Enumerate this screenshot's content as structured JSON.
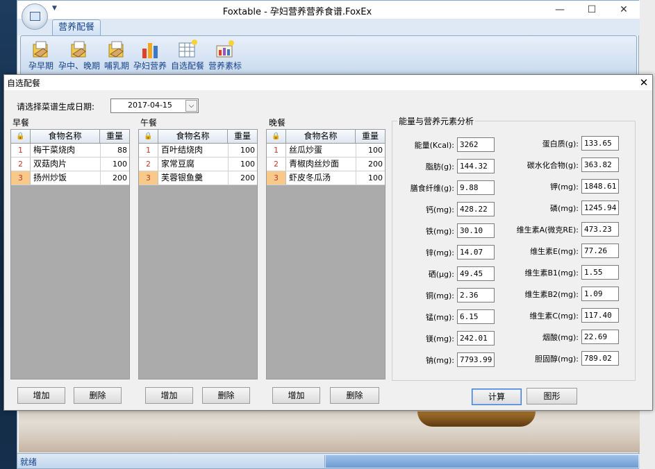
{
  "app": {
    "title": "Foxtable - 孕妇营养营养食谱.FoxEx",
    "qat_icon": "dropdown-arrow",
    "ribbon_tab": "营养配餐",
    "ribbon_buttons": [
      {
        "label": "孕早期",
        "icon": "folder-hand-icon"
      },
      {
        "label": "孕中、晚期",
        "icon": "folder-hand-icon"
      },
      {
        "label": "哺乳期",
        "icon": "folder-hand-icon"
      },
      {
        "label": "孕妇营养",
        "icon": "bar-chart-icon"
      },
      {
        "label": "自选配餐",
        "icon": "table-star-icon"
      },
      {
        "label": "营养素标",
        "icon": "chart-star-icon"
      }
    ],
    "status": "就绪",
    "window_controls": {
      "minimize": "—",
      "maximize": "☐",
      "close": "✕"
    }
  },
  "dialog": {
    "title": "自选配餐",
    "close": "✕",
    "date_label": "请选择菜谱生成日期:",
    "date_value": "2017-04-15",
    "date_drop": "⌵",
    "grid_header": {
      "corner": "🔒",
      "name": "食物名称",
      "weight": "重量"
    },
    "meals": [
      {
        "title": "早餐",
        "rows": [
          {
            "n": "1",
            "name": "梅干菜烧肉",
            "weight": "88"
          },
          {
            "n": "2",
            "name": "双菇肉片",
            "weight": "100"
          },
          {
            "n": "3",
            "name": "扬州炒饭",
            "weight": "200"
          }
        ],
        "add": "增加",
        "del": "删除"
      },
      {
        "title": "午餐",
        "rows": [
          {
            "n": "1",
            "name": "百叶结烧肉",
            "weight": "100"
          },
          {
            "n": "2",
            "name": "家常豆腐",
            "weight": "100"
          },
          {
            "n": "3",
            "name": "芙蓉银鱼羹",
            "weight": "200"
          }
        ],
        "add": "增加",
        "del": "删除"
      },
      {
        "title": "晚餐",
        "rows": [
          {
            "n": "1",
            "name": "丝瓜炒蛋",
            "weight": "100"
          },
          {
            "n": "2",
            "name": "青椒肉丝炒面",
            "weight": "200"
          },
          {
            "n": "3",
            "name": "虾皮冬瓜汤",
            "weight": "100"
          }
        ],
        "add": "增加",
        "del": "删除"
      }
    ],
    "nutrition": {
      "title": "能量与营养元素分析",
      "left": [
        {
          "label": "能量(Kcal):",
          "value": "3262"
        },
        {
          "label": "脂肪(g):",
          "value": "144.32"
        },
        {
          "label": "膳食纤维(g):",
          "value": "9.88"
        },
        {
          "label": "钙(mg):",
          "value": "428.22"
        },
        {
          "label": "铁(mg):",
          "value": "30.10"
        },
        {
          "label": "锌(mg):",
          "value": "14.07"
        },
        {
          "label": "硒(μg):",
          "value": "49.45"
        },
        {
          "label": "铜(mg):",
          "value": "2.36"
        },
        {
          "label": "锰(mg):",
          "value": "6.15"
        },
        {
          "label": "镁(mg):",
          "value": "242.01"
        },
        {
          "label": "钠(mg):",
          "value": "7793.99"
        }
      ],
      "right": [
        {
          "label": "蛋白质(g):",
          "value": "133.65"
        },
        {
          "label": "碳水化合物(g):",
          "value": "363.82"
        },
        {
          "label": "钾(mg):",
          "value": "1848.61"
        },
        {
          "label": "磷(mg):",
          "value": "1245.94"
        },
        {
          "label": "维生素A(微克RE):",
          "value": "473.23"
        },
        {
          "label": "维生素E(mg):",
          "value": "77.26"
        },
        {
          "label": "维生素B1(mg):",
          "value": "1.55"
        },
        {
          "label": "维生素B2(mg):",
          "value": "1.09"
        },
        {
          "label": "维生素C(mg):",
          "value": "117.40"
        },
        {
          "label": "烟酸(mg):",
          "value": "22.69"
        },
        {
          "label": "胆固醇(mg):",
          "value": "789.02"
        }
      ],
      "calc": "计算",
      "graph": "图形"
    }
  }
}
